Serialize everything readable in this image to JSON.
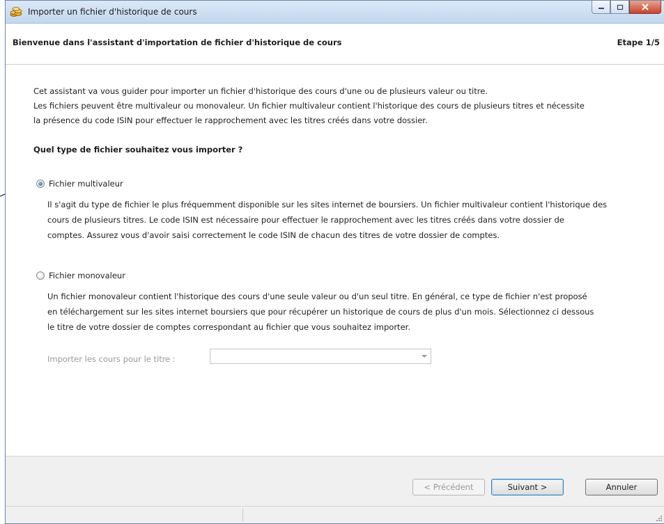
{
  "window": {
    "title": "Importer un fichier d'historique de cours",
    "icons": {
      "app": "coins-icon",
      "minimize": "minimize-icon",
      "maximize": "maximize-icon",
      "close": "close-icon"
    }
  },
  "header": {
    "title": "Bienvenue dans l'assistant d'importation de fichier d'historique de cours",
    "step": "Etape 1/5"
  },
  "intro": {
    "line1": "Cet assistant va vous guider pour importer un fichier d'historique des cours d'une ou de plusieurs valeur ou titre.",
    "line2": "Les fichiers peuvent être multivaleur ou monovaleur. Un fichier multivaleur contient l'historique des cours de plusieurs titres et nécessite",
    "line3": "la présence du code ISIN pour effectuer le rapprochement avec les titres créés dans votre dossier."
  },
  "question": "Quel type de fichier souhaitez vous importer ?",
  "options": {
    "multi": {
      "label": "Fichier multivaleur",
      "checked": true,
      "desc1": "Il s'agit du type de fichier le plus fréquemment disponible sur les sites internet de boursiers. Un fichier multivaleur contient l'historique des",
      "desc2": "cours de plusieurs titres. Le code ISIN est nécessaire pour effectuer le rapprochement avec les titres créés dans votre dossier de",
      "desc3": "comptes. Assurez vous d'avoir saisi correctement le code ISIN de chacun des titres de votre dossier de comptes."
    },
    "mono": {
      "label": "Fichier monovaleur",
      "checked": false,
      "desc1": "Un fichier monovaleur contient l'historique des cours d'une seule valeur ou d'un seul titre. En général, ce type de fichier n'est proposé",
      "desc2": "en téléchargement sur les sites internet boursiers que pour récupérer un historique de cours de plus d'un mois. Sélectionnez ci dessous",
      "desc3": "le titre de votre dossier de comptes correspondant au fichier que vous souhaitez importer."
    }
  },
  "title_select": {
    "label": "Importer les cours pour le titre :",
    "value": ""
  },
  "buttons": {
    "previous": "< Précédent",
    "next": "Suivant >",
    "cancel": "Annuler"
  }
}
